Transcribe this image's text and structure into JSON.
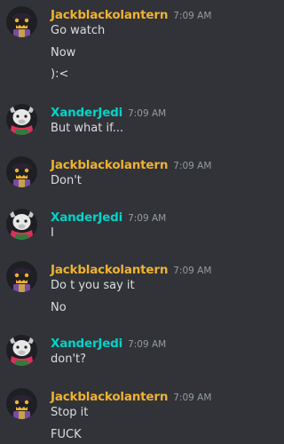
{
  "users": {
    "jack": {
      "name": "Jackblackolantern",
      "color": "#f0b232"
    },
    "xander": {
      "name": "XanderJedi",
      "color": "#00d4c8"
    }
  },
  "groups": [
    {
      "user": "Jackblackolantern",
      "avatar": "jack-o-lantern-avatar-icon",
      "time": "7:09 AM",
      "lines": [
        "Go watch",
        "Now",
        "):<"
      ]
    },
    {
      "user": "XanderJedi",
      "avatar": "goat-avatar-icon",
      "time": "7:09 AM",
      "lines": [
        "But what if..."
      ]
    },
    {
      "user": "Jackblackolantern",
      "avatar": "jack-o-lantern-avatar-icon",
      "time": "7:09 AM",
      "lines": [
        "Don't"
      ]
    },
    {
      "user": "XanderJedi",
      "avatar": "goat-avatar-icon",
      "time": "7:09 AM",
      "lines": [
        "I"
      ]
    },
    {
      "user": "Jackblackolantern",
      "avatar": "jack-o-lantern-avatar-icon",
      "time": "7:09 AM",
      "lines": [
        "Do t you say it",
        "No"
      ]
    },
    {
      "user": "XanderJedi",
      "avatar": "goat-avatar-icon",
      "time": "7:09 AM",
      "lines": [
        "don't?"
      ]
    },
    {
      "user": "Jackblackolantern",
      "avatar": "jack-o-lantern-avatar-icon",
      "time": "7:09 AM",
      "lines": [
        "Stop it",
        "FUCK"
      ]
    }
  ]
}
